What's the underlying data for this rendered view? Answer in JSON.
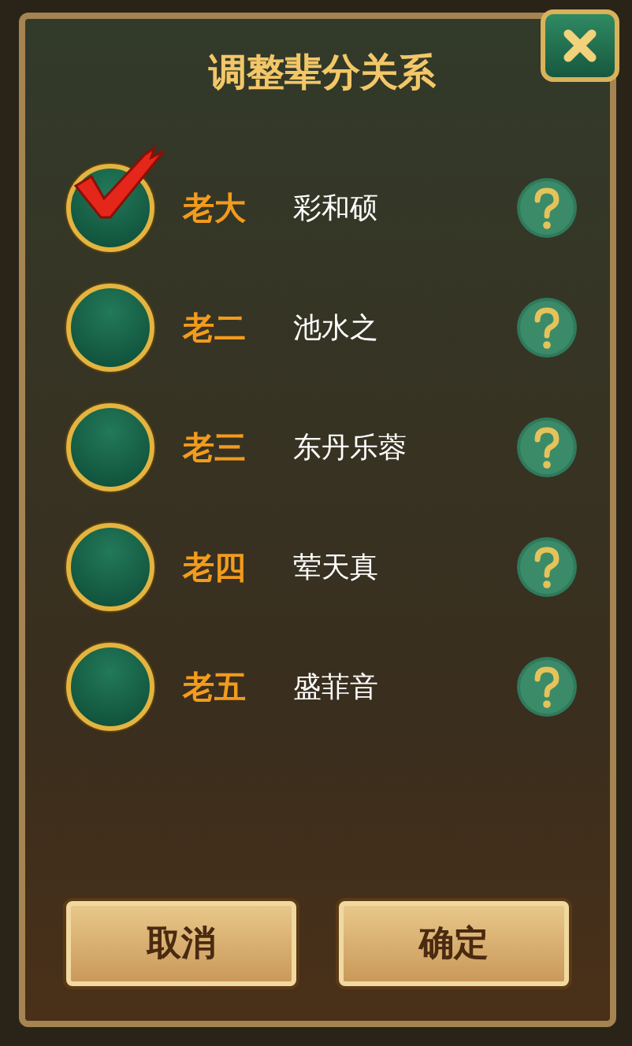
{
  "dialog": {
    "title": "调整辈分关系"
  },
  "rows": [
    {
      "rank": "老大",
      "name": "彩和硕",
      "selected": true
    },
    {
      "rank": "老二",
      "name": "池水之",
      "selected": false
    },
    {
      "rank": "老三",
      "name": "东丹乐蓉",
      "selected": false
    },
    {
      "rank": "老四",
      "name": "荤天真",
      "selected": false
    },
    {
      "rank": "老五",
      "name": "盛菲音",
      "selected": false
    }
  ],
  "buttons": [
    {
      "label": "取消"
    },
    {
      "label": "确定"
    }
  ]
}
